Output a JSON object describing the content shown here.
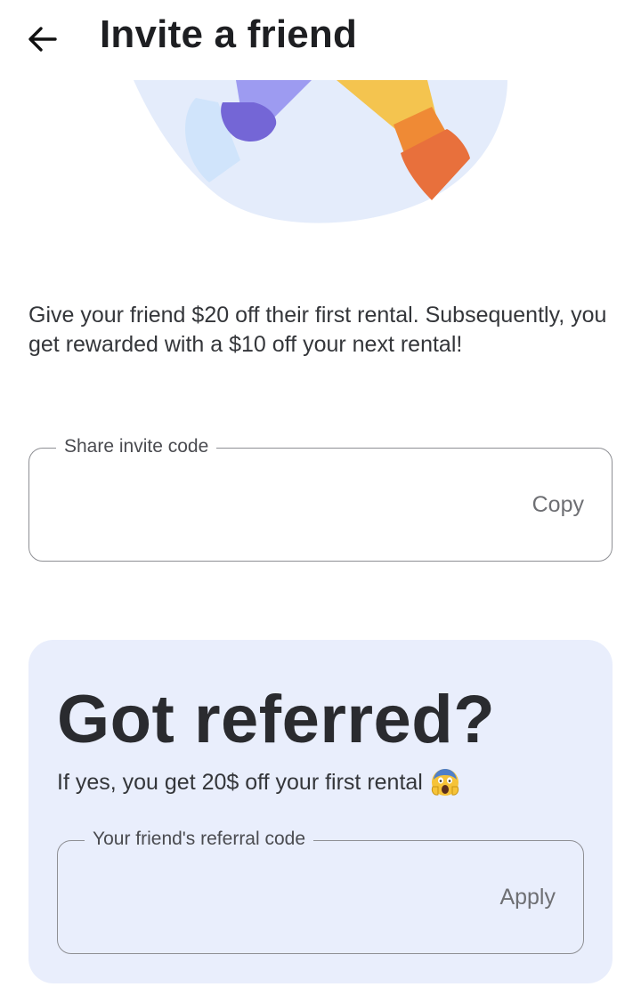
{
  "header": {
    "title": "Invite a friend",
    "back_icon": "arrow-left-icon"
  },
  "hero": {
    "illustration": "hands-illustration",
    "colors": {
      "blob": "#e3ebfb",
      "blob_light": "#cfe2fb",
      "purple_sleeve": "#9b98f0",
      "purple_hand": "#7466d6",
      "yellow_sleeve": "#f4c24c",
      "orange_cuff": "#ee8536",
      "orange_hand": "#e86f3a"
    }
  },
  "description": "Give your friend $20 off their first rental. Subsequently, you get rewarded with a $10 off your next rental!",
  "invite": {
    "label": "Share invite code",
    "value": "",
    "action": "Copy"
  },
  "referred": {
    "title": "Got referred?",
    "subtitle": "If yes, you get 20$ off your first rental",
    "emoji": "screaming-face-emoji",
    "field_label": "Your friend's referral code",
    "field_value": "",
    "action": "Apply",
    "card_color": "#e9eefc"
  }
}
